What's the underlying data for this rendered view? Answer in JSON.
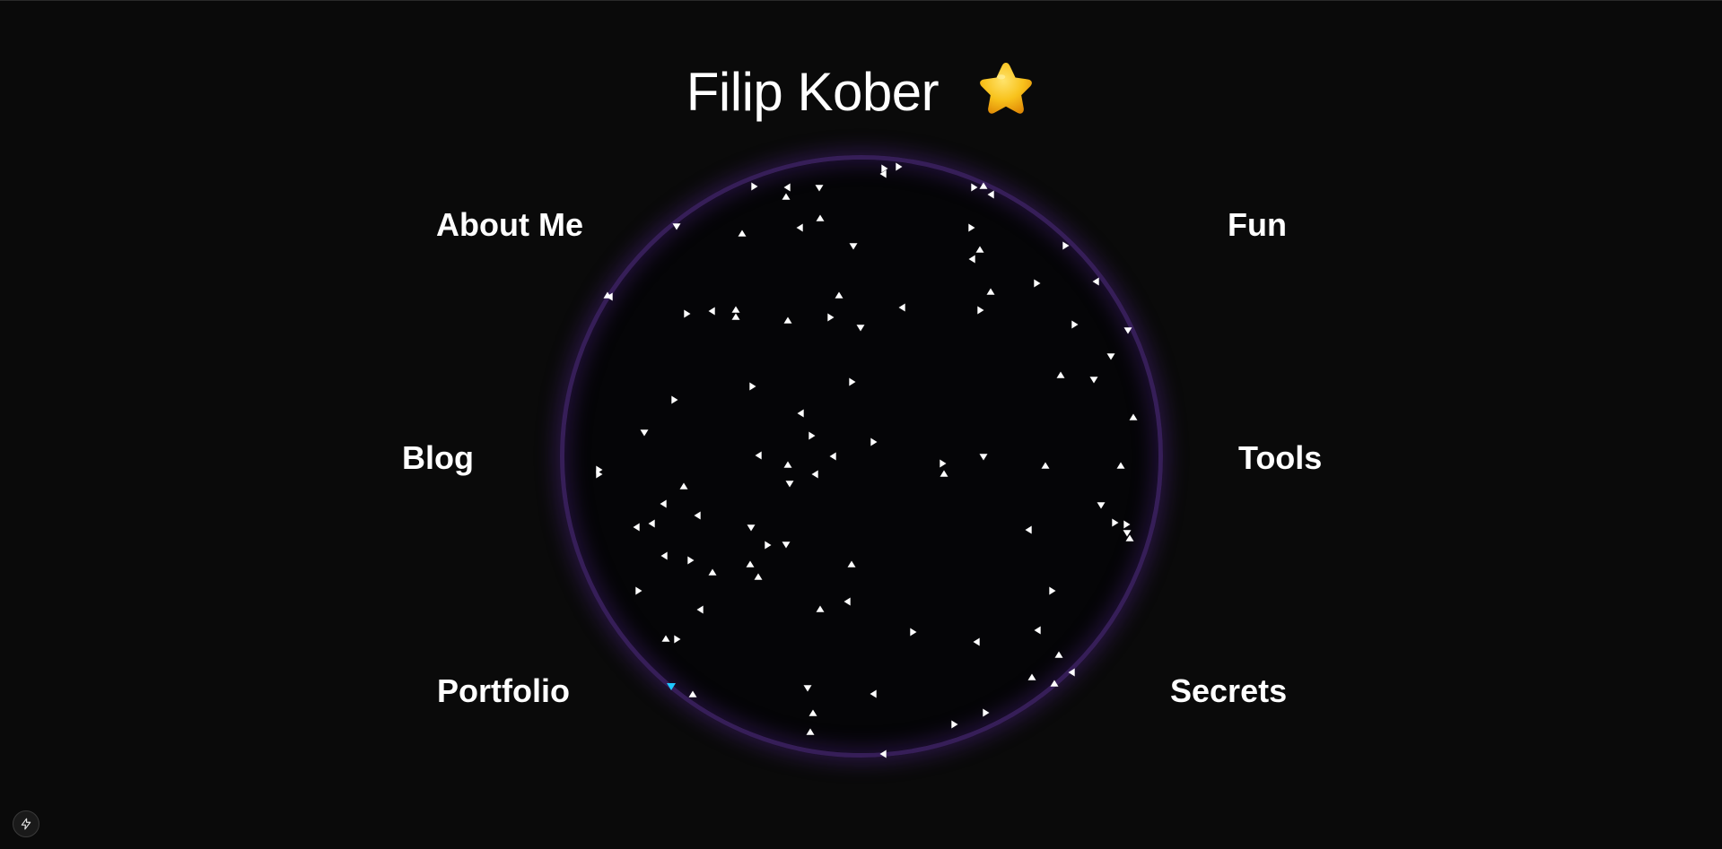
{
  "header": {
    "title": "Filip Kober",
    "star_icon": "star-emoji-icon"
  },
  "nav": {
    "about": "About Me",
    "fun": "Fun",
    "blog": "Blog",
    "tools": "Tools",
    "portfolio": "Portfolio",
    "secrets": "Secrets"
  },
  "colors": {
    "background": "#0a0a0a",
    "ring": "#462673",
    "particle": "#ffffff",
    "particle_highlight": "#1ec8ff",
    "star": "#f5b915"
  },
  "dev_tools": {
    "icon": "bolt-icon"
  }
}
